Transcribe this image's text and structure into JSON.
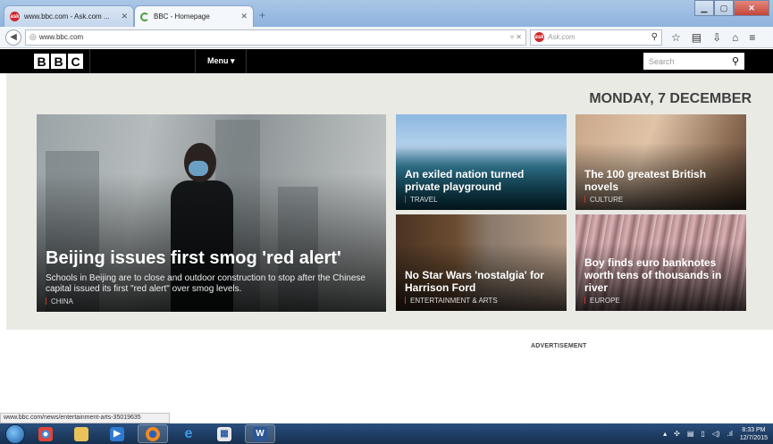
{
  "browser": {
    "tabs": [
      {
        "title": "www.bbc.com - Ask.com ...",
        "active": false
      },
      {
        "title": "BBC - Homepage",
        "active": true
      }
    ],
    "new_tab": "+",
    "url": "www.bbc.com",
    "search_engine": "Ask.com",
    "status_url": "www.bbc.com/news/entertainment-arts-35019635"
  },
  "bbc": {
    "logo": [
      "B",
      "B",
      "C"
    ],
    "menu_label": "Menu",
    "search_placeholder": "Search",
    "date": "MONDAY, 7 DECEMBER",
    "main_story": {
      "headline": "Beijing issues first smog 'red alert'",
      "summary": "Schools in Beijing are to close and outdoor construction to stop after the Chinese capital issued its first \"red alert\" over smog levels.",
      "tag": "CHINA"
    },
    "stories": [
      {
        "headline": "An exiled nation turned private playground",
        "tag": "TRAVEL"
      },
      {
        "headline": "The 100 greatest British novels",
        "tag": "CULTURE"
      },
      {
        "headline": "No Star Wars 'nostalgia' for Harrison Ford",
        "tag": "ENTERTAINMENT & ARTS"
      },
      {
        "headline": "Boy finds euro banknotes worth tens of thousands in river",
        "tag": "EUROPE"
      }
    ],
    "advertisement": "ADVERTISEMENT"
  },
  "taskbar": {
    "time": "8:33 PM",
    "date": "12/7/2015",
    "word_label": "W"
  },
  "colors": {
    "bbc_black": "#000000",
    "content_bg": "#eaeae5",
    "tag_accent": "#c0392b"
  }
}
